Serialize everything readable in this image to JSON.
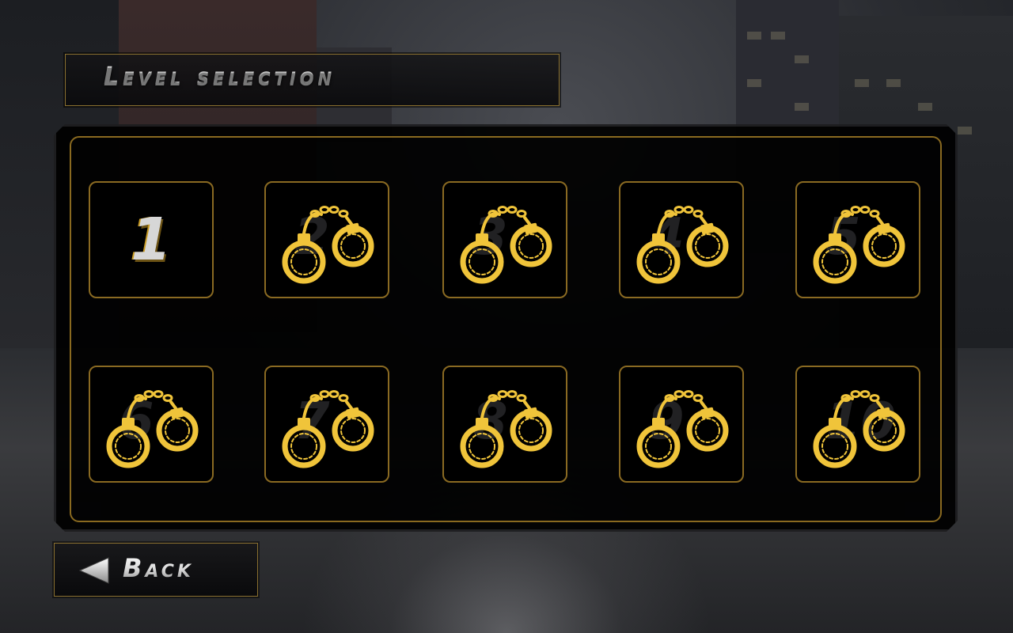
{
  "header": {
    "title": "Level selection"
  },
  "levels": [
    {
      "label": "1",
      "locked": false,
      "icon": "level-number"
    },
    {
      "label": "2",
      "locked": true,
      "icon": "handcuffs-icon"
    },
    {
      "label": "3",
      "locked": true,
      "icon": "handcuffs-icon"
    },
    {
      "label": "4",
      "locked": true,
      "icon": "handcuffs-icon"
    },
    {
      "label": "5",
      "locked": true,
      "icon": "handcuffs-icon"
    },
    {
      "label": "6",
      "locked": true,
      "icon": "handcuffs-icon"
    },
    {
      "label": "7",
      "locked": true,
      "icon": "handcuffs-icon"
    },
    {
      "label": "8",
      "locked": true,
      "icon": "handcuffs-icon"
    },
    {
      "label": "9",
      "locked": true,
      "icon": "handcuffs-icon"
    },
    {
      "label": "10",
      "locked": true,
      "icon": "handcuffs-icon"
    }
  ],
  "back": {
    "label": "Back",
    "icon": "back-arrow-icon"
  },
  "colors": {
    "accent_gold": "#f0c43a",
    "border_gold": "#8a6a22",
    "panel": "#000000"
  }
}
